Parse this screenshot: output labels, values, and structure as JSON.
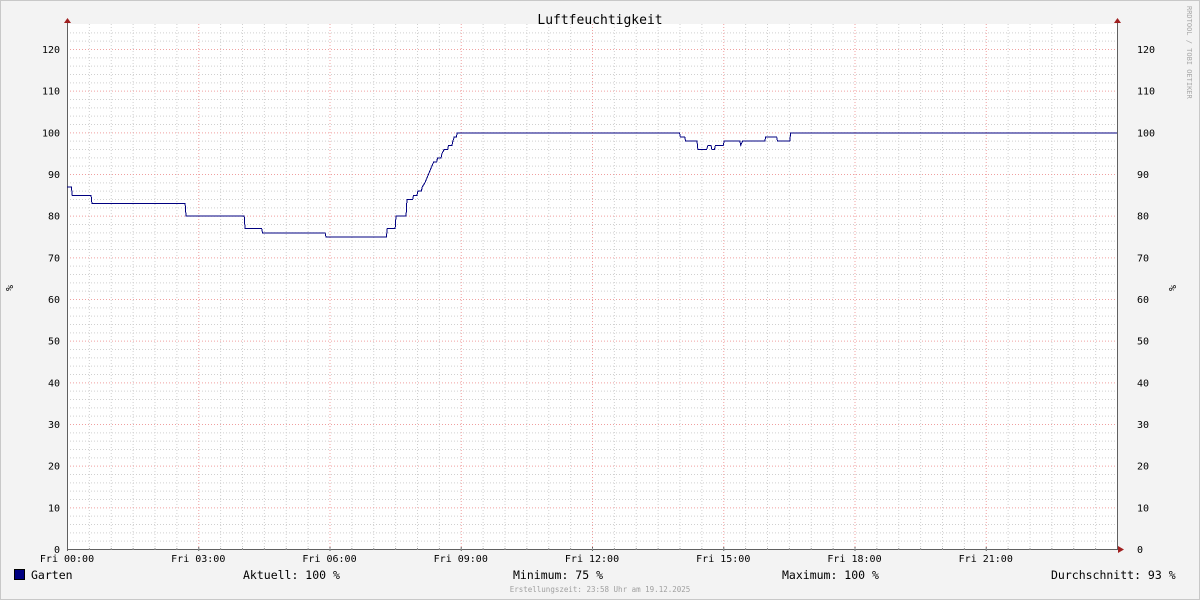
{
  "chart_data": {
    "type": "line",
    "title": "Luftfeuchtigkeit",
    "ylabel_left": "%",
    "ylabel_right": "%",
    "watermark": "RRDTOOL / TOBI OETIKER",
    "ylim": [
      0,
      126
    ],
    "yticks": [
      0,
      10,
      20,
      30,
      40,
      50,
      60,
      70,
      80,
      90,
      100,
      110,
      120
    ],
    "xlim": [
      0,
      24
    ],
    "xticks": [
      {
        "x": 0,
        "label": "Fri 00:00"
      },
      {
        "x": 3,
        "label": "Fri 03:00"
      },
      {
        "x": 6,
        "label": "Fri 06:00"
      },
      {
        "x": 9,
        "label": "Fri 09:00"
      },
      {
        "x": 12,
        "label": "Fri 12:00"
      },
      {
        "x": 15,
        "label": "Fri 15:00"
      },
      {
        "x": 18,
        "label": "Fri 18:00"
      },
      {
        "x": 21,
        "label": "Fri 21:00"
      }
    ],
    "grid": true,
    "series": [
      {
        "name": "Garten",
        "color": "#000080",
        "points": [
          [
            0.0,
            87
          ],
          [
            0.1,
            87
          ],
          [
            0.12,
            85
          ],
          [
            0.55,
            85
          ],
          [
            0.57,
            83
          ],
          [
            2.7,
            83
          ],
          [
            2.72,
            80
          ],
          [
            4.05,
            80
          ],
          [
            4.07,
            77
          ],
          [
            4.45,
            77
          ],
          [
            4.47,
            76
          ],
          [
            5.9,
            76
          ],
          [
            5.92,
            75
          ],
          [
            7.3,
            75
          ],
          [
            7.32,
            77
          ],
          [
            7.5,
            77
          ],
          [
            7.52,
            80
          ],
          [
            7.75,
            80
          ],
          [
            7.77,
            84
          ],
          [
            7.9,
            84
          ],
          [
            7.92,
            85
          ],
          [
            8.0,
            85
          ],
          [
            8.02,
            86
          ],
          [
            8.1,
            86
          ],
          [
            8.12,
            87
          ],
          [
            8.18,
            88
          ],
          [
            8.22,
            89
          ],
          [
            8.26,
            90
          ],
          [
            8.3,
            91
          ],
          [
            8.34,
            92
          ],
          [
            8.38,
            93
          ],
          [
            8.45,
            93
          ],
          [
            8.47,
            94
          ],
          [
            8.55,
            94
          ],
          [
            8.57,
            95
          ],
          [
            8.62,
            96
          ],
          [
            8.7,
            96
          ],
          [
            8.72,
            97
          ],
          [
            8.8,
            97
          ],
          [
            8.82,
            98
          ],
          [
            8.85,
            99
          ],
          [
            8.9,
            99
          ],
          [
            8.92,
            100
          ],
          [
            14.0,
            100
          ],
          [
            14.02,
            99
          ],
          [
            14.12,
            99
          ],
          [
            14.14,
            98
          ],
          [
            14.4,
            98
          ],
          [
            14.42,
            96
          ],
          [
            14.55,
            96
          ],
          [
            14.57,
            96
          ],
          [
            14.62,
            96
          ],
          [
            14.65,
            97
          ],
          [
            14.72,
            97
          ],
          [
            14.74,
            96
          ],
          [
            14.8,
            96
          ],
          [
            14.82,
            97
          ],
          [
            15.0,
            97
          ],
          [
            15.02,
            98
          ],
          [
            15.38,
            98
          ],
          [
            15.4,
            97
          ],
          [
            15.44,
            98
          ],
          [
            15.95,
            98
          ],
          [
            15.97,
            99
          ],
          [
            16.22,
            99
          ],
          [
            16.24,
            98
          ],
          [
            16.52,
            98
          ],
          [
            16.54,
            100
          ],
          [
            24.0,
            100
          ]
        ]
      }
    ],
    "stats": {
      "name": "Garten",
      "aktuell": "Aktuell: 100 %",
      "minimum": "Minimum:  75 %",
      "maximum": "Maximum: 100 %",
      "durchschnitt": "Durchschnitt:  93 %"
    },
    "footer": "Erstellungszeit: 23:58 Uhr am 19.12.2025"
  }
}
